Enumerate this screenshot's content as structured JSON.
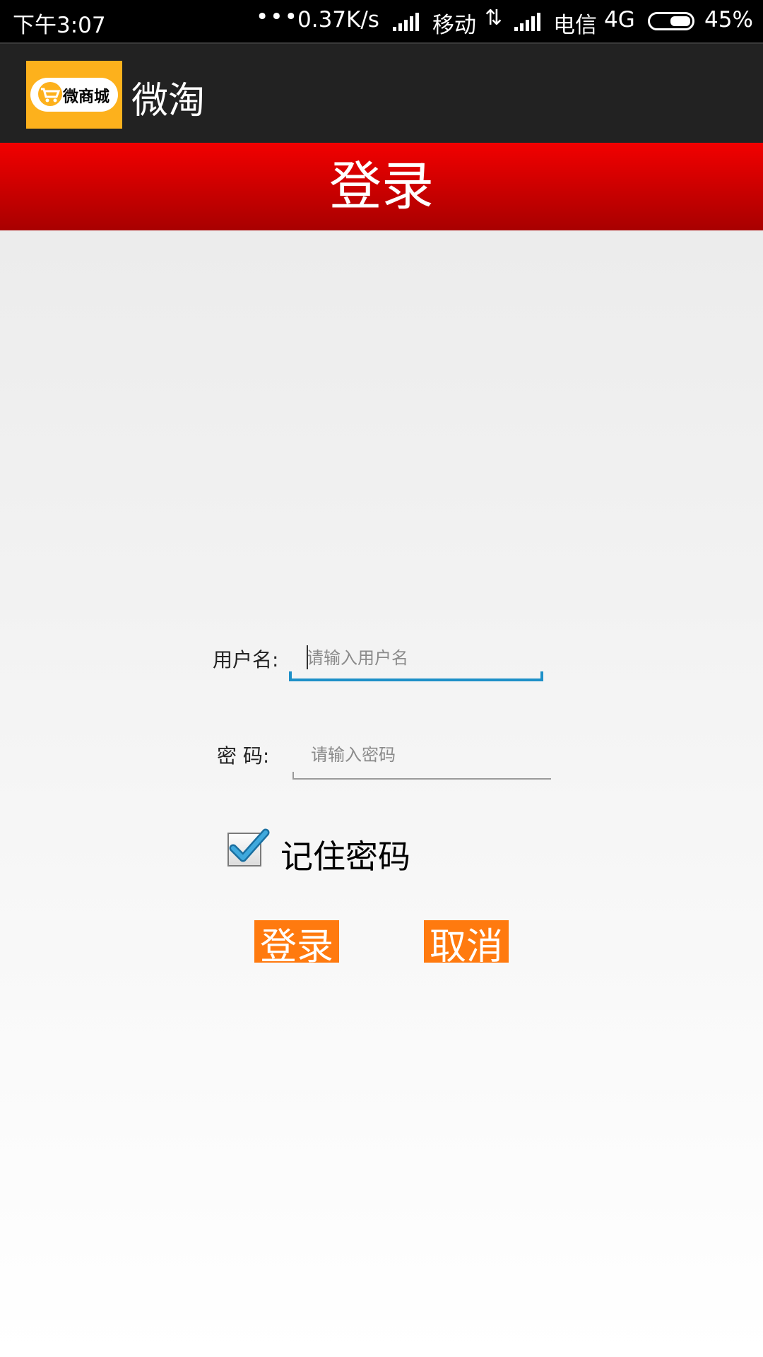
{
  "status_bar": {
    "time": "下午3:07",
    "dots": "•••",
    "network_speed": "0.37K/s",
    "carrier1": "移动",
    "data_arrows": "⇅",
    "carrier2": "电信",
    "network_type": "4G",
    "battery_percent": "45%",
    "battery_level": 0.45
  },
  "app_bar": {
    "logo_text": "微商城",
    "title": "微淘"
  },
  "header": {
    "title": "登录"
  },
  "form": {
    "username_label": "用户名:",
    "username_placeholder": "请输入用户名",
    "username_value": "",
    "password_label": "密  码:",
    "password_placeholder": "请输入密码",
    "password_value": "",
    "remember_label": "记住密码",
    "remember_checked": true
  },
  "buttons": {
    "login_label": "登录",
    "cancel_label": "取消"
  },
  "colors": {
    "header_red": "#e00000",
    "button_orange": "#ff7a0f",
    "focus_blue": "#1e90c8",
    "logo_yellow": "#fdb11c"
  }
}
